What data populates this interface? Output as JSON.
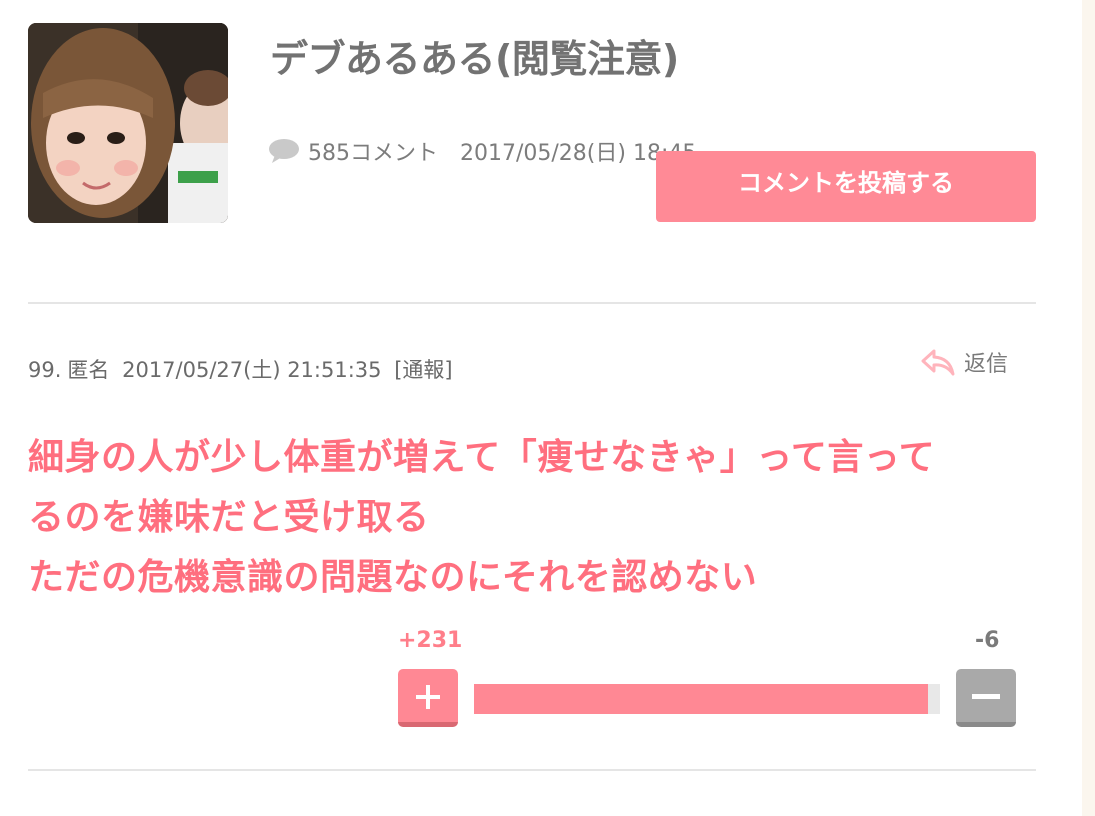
{
  "topic": {
    "title": "デブあるある(閲覧注意)",
    "thumbnail_icon": "topic-photo",
    "comment_count": "585コメント",
    "date": "2017/05/28(日) 18:45",
    "post_button_label": "コメントを投稿する"
  },
  "comment": {
    "number": "99.",
    "author": "匿名",
    "datetime": "2017/05/27(土) 21:51:35",
    "report_label": "[通報]",
    "reply_label": "返信",
    "body_lines": [
      "細身の人が少し体重が増えて「痩せなきゃ」って言って",
      "るのを嫌味だと受け取る",
      "ただの危機意識の問題なのにそれを認めない"
    ],
    "plus_votes": "+231",
    "minus_votes": "-6",
    "plus_ratio": 0.975
  },
  "colors": {
    "accent": "#ff8894",
    "comment_text": "#ff6f7f",
    "meta_text": "#7c7c7c",
    "minus_button": "#a9a9a9"
  }
}
